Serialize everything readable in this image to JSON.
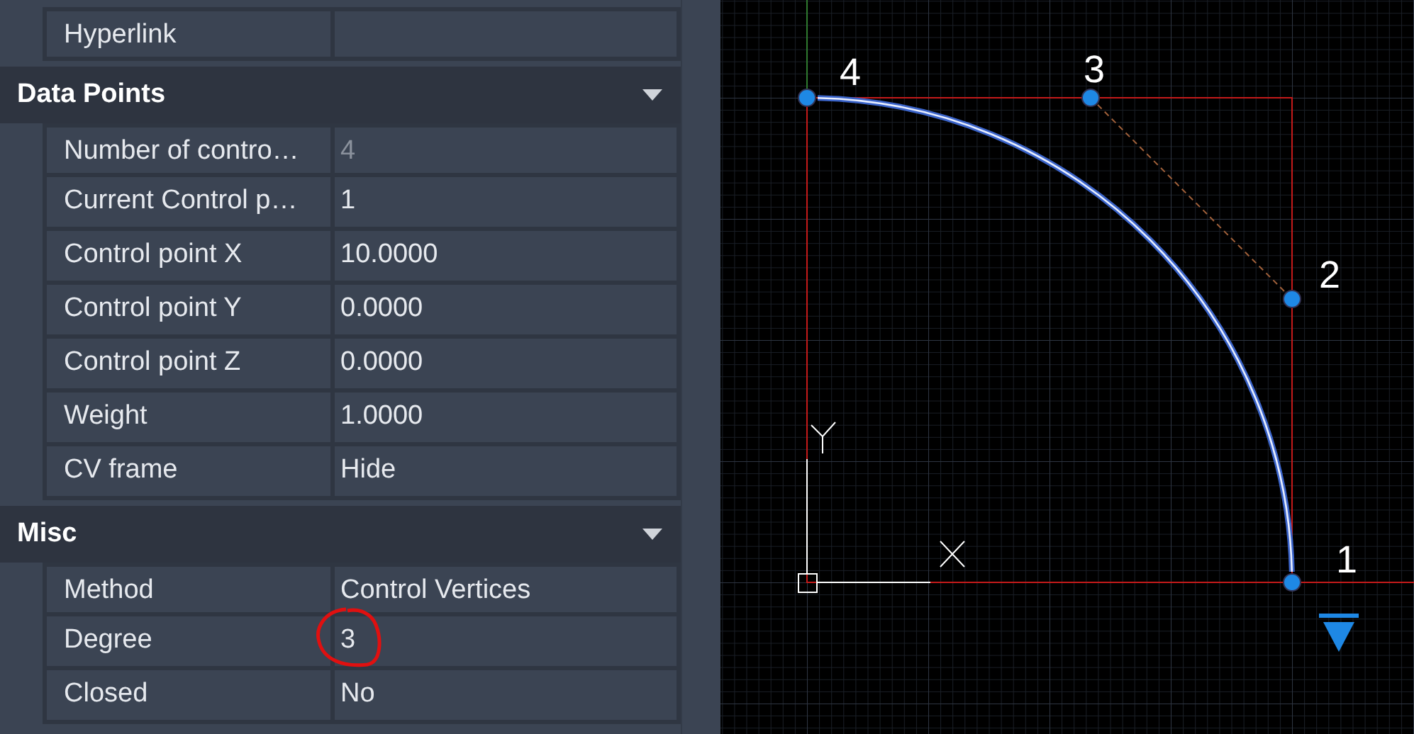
{
  "properties": {
    "top_rows": [
      {
        "label": "Hyperlink"
      }
    ],
    "sections": [
      {
        "title": "Data Points",
        "expanded": true,
        "rows": [
          {
            "label": "Number of contro…",
            "value": "4",
            "disabled": true,
            "highlighted": false
          },
          {
            "label": "Current Control p…",
            "value": "1",
            "disabled": false,
            "highlighted": false
          },
          {
            "label": "Control point X",
            "value": "10.0000",
            "disabled": false,
            "highlighted": false
          },
          {
            "label": "Control point Y",
            "value": "0.0000",
            "disabled": false,
            "highlighted": false
          },
          {
            "label": "Control point Z",
            "value": "0.0000",
            "disabled": false,
            "highlighted": false
          },
          {
            "label": "Weight",
            "value": "1.0000",
            "disabled": false,
            "highlighted": false
          },
          {
            "label": "CV frame",
            "value": "Hide",
            "disabled": false,
            "highlighted": false
          }
        ]
      },
      {
        "title": "Misc",
        "expanded": true,
        "rows": [
          {
            "label": "Method",
            "value": "Control Vertices",
            "disabled": false,
            "highlighted": false
          },
          {
            "label": "Degree",
            "value": "3",
            "disabled": false,
            "highlighted": true
          },
          {
            "label": "Closed",
            "value": "No",
            "disabled": false,
            "highlighted": false
          }
        ]
      }
    ]
  },
  "canvas": {
    "control_points": [
      {
        "label": "1"
      },
      {
        "label": "2"
      },
      {
        "label": "3"
      },
      {
        "label": "4"
      }
    ]
  }
}
